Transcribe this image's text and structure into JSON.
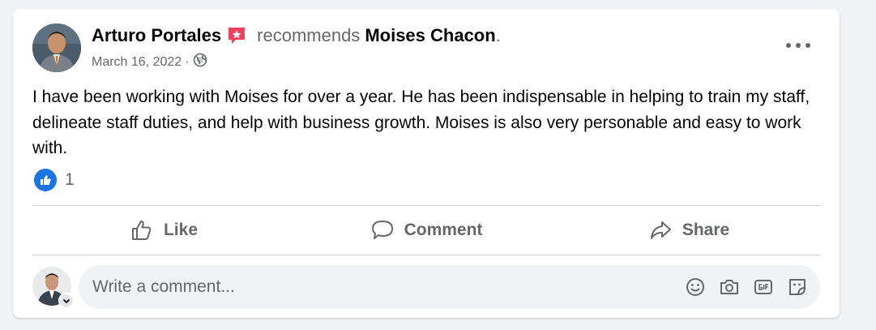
{
  "post": {
    "author": "Arturo Portales",
    "verb": "recommends",
    "target": "Moises Chacon",
    "period": ".",
    "date": "March 16, 2022",
    "dot": "·",
    "audience_icon": "globe-icon",
    "text": "I have been working with Moises for over a year. He has been indispensable in helping to train my staff, delineate staff duties, and help with business growth. Moises is also very personable and easy to work with.",
    "reaction_count": "1",
    "reaction_icon": "like-icon"
  },
  "actions": {
    "like": "Like",
    "comment": "Comment",
    "share": "Share"
  },
  "comment_input": {
    "placeholder": "Write a comment...",
    "icons": [
      "emoji-icon",
      "camera-icon",
      "gif-icon",
      "sticker-icon"
    ]
  },
  "colors": {
    "accent": "#1b74e4",
    "recommend_badge": "#f3425f",
    "secondary_text": "#65676b"
  }
}
